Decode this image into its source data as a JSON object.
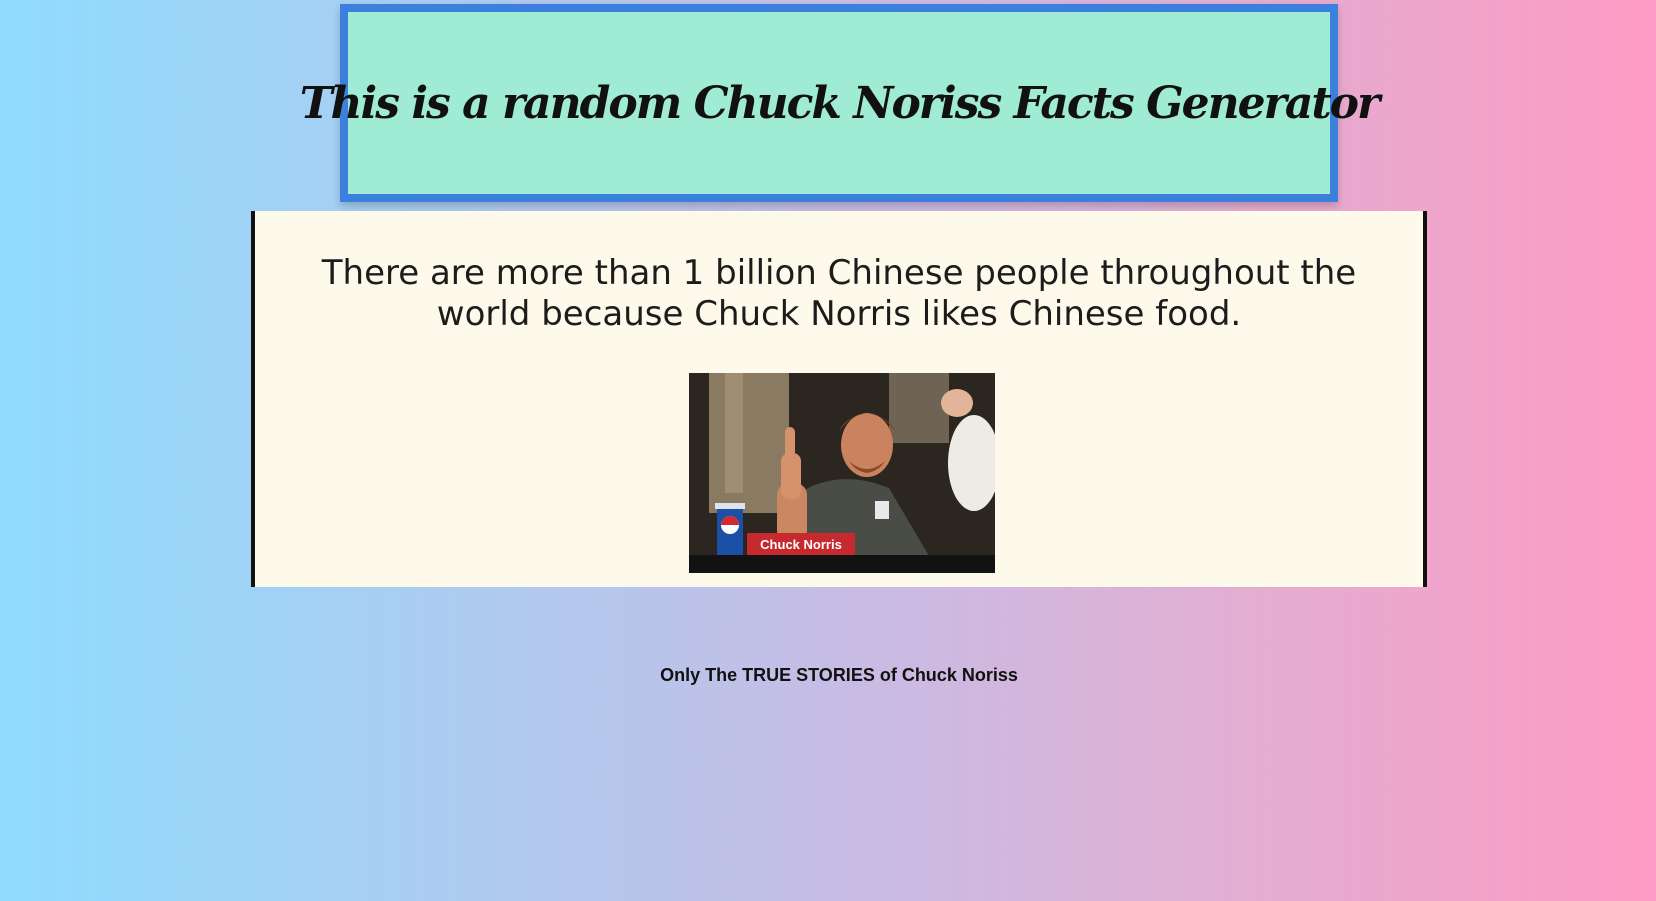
{
  "header": {
    "title": "This is a random Chuck Noriss Facts Generator"
  },
  "fact": {
    "text": "There are more than 1 billion Chinese people throughout the world because Chuck Norris likes Chinese food.",
    "image_caption": "Chuck Norris"
  },
  "footer": {
    "text": "Only The TRUE STORIES of Chuck Noriss"
  },
  "colors": {
    "header_background": "#a0ebd3",
    "header_border": "#3b80dc",
    "fact_background": "#fefaeb"
  }
}
